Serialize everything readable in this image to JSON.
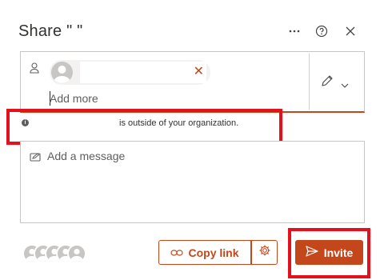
{
  "dialog": {
    "title": "Share \"                    \"",
    "header_icons": [
      "more-icon",
      "help-icon",
      "close-icon"
    ]
  },
  "recipients": {
    "chip_remove_symbol": "✕",
    "input_placeholder": "Add more",
    "permission_icon": "pencil-icon"
  },
  "notice": {
    "text": "is outside of your organization."
  },
  "message": {
    "placeholder": "Add a message"
  },
  "footer": {
    "copy_link_label": "Copy link",
    "invite_label": "Invite",
    "settings_icon": "gear-icon"
  },
  "colors": {
    "accent": "#c4471c",
    "highlight": "#e3111b"
  }
}
